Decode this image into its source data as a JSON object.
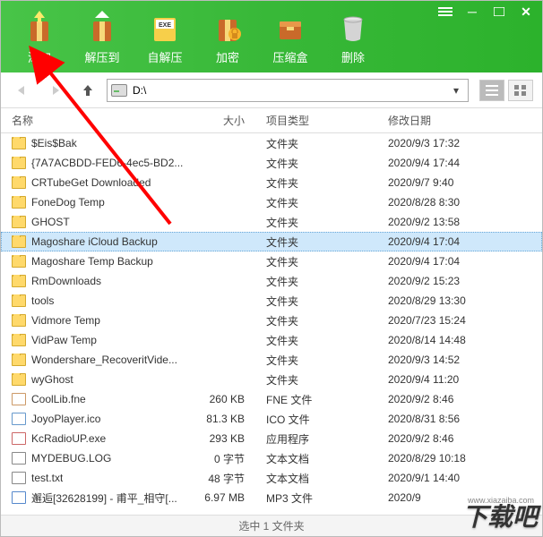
{
  "toolbar": {
    "add": "添加",
    "extract": "解压到",
    "sfx": "自解压",
    "encrypt": "加密",
    "archive_box": "压缩盒",
    "delete": "删除"
  },
  "nav": {
    "path": "D:\\"
  },
  "columns": {
    "name": "名称",
    "size": "大小",
    "type": "项目类型",
    "date": "修改日期"
  },
  "files": [
    {
      "icon": "folder",
      "name": "$Eis$Bak",
      "size": "",
      "type": "文件夹",
      "date": "2020/9/3 17:32",
      "selected": false
    },
    {
      "icon": "folder",
      "name": "{7A7ACBDD-FED6-4ec5-BD2...",
      "size": "",
      "type": "文件夹",
      "date": "2020/9/4 17:44",
      "selected": false
    },
    {
      "icon": "folder",
      "name": "CRTubeGet Downloaded",
      "size": "",
      "type": "文件夹",
      "date": "2020/9/7 9:40",
      "selected": false
    },
    {
      "icon": "folder",
      "name": "FoneDog Temp",
      "size": "",
      "type": "文件夹",
      "date": "2020/8/28 8:30",
      "selected": false
    },
    {
      "icon": "folder",
      "name": "GHOST",
      "size": "",
      "type": "文件夹",
      "date": "2020/9/2 13:58",
      "selected": false
    },
    {
      "icon": "folder",
      "name": "Magoshare iCloud Backup",
      "size": "",
      "type": "文件夹",
      "date": "2020/9/4 17:04",
      "selected": true
    },
    {
      "icon": "folder",
      "name": "Magoshare Temp Backup",
      "size": "",
      "type": "文件夹",
      "date": "2020/9/4 17:04",
      "selected": false
    },
    {
      "icon": "folder",
      "name": "RmDownloads",
      "size": "",
      "type": "文件夹",
      "date": "2020/9/2 15:23",
      "selected": false
    },
    {
      "icon": "folder",
      "name": "tools",
      "size": "",
      "type": "文件夹",
      "date": "2020/8/29 13:30",
      "selected": false
    },
    {
      "icon": "folder",
      "name": "Vidmore Temp",
      "size": "",
      "type": "文件夹",
      "date": "2020/7/23 15:24",
      "selected": false
    },
    {
      "icon": "folder",
      "name": "VidPaw Temp",
      "size": "",
      "type": "文件夹",
      "date": "2020/8/14 14:48",
      "selected": false
    },
    {
      "icon": "folder",
      "name": "Wondershare_RecoveritVide...",
      "size": "",
      "type": "文件夹",
      "date": "2020/9/3 14:52",
      "selected": false
    },
    {
      "icon": "folder",
      "name": "wyGhost",
      "size": "",
      "type": "文件夹",
      "date": "2020/9/4 11:20",
      "selected": false
    },
    {
      "icon": "file fne",
      "name": "CoolLib.fne",
      "size": "260 KB",
      "type": "FNE 文件",
      "date": "2020/9/2 8:46",
      "selected": false
    },
    {
      "icon": "file ico",
      "name": "JoyoPlayer.ico",
      "size": "81.3 KB",
      "type": "ICO 文件",
      "date": "2020/8/31 8:56",
      "selected": false
    },
    {
      "icon": "file exe",
      "name": "KcRadioUP.exe",
      "size": "293 KB",
      "type": "应用程序",
      "date": "2020/9/2 8:46",
      "selected": false
    },
    {
      "icon": "file txt",
      "name": "MYDEBUG.LOG",
      "size": "0 字节",
      "type": "文本文档",
      "date": "2020/8/29 10:18",
      "selected": false
    },
    {
      "icon": "file txt",
      "name": "test.txt",
      "size": "48 字节",
      "type": "文本文档",
      "date": "2020/9/1 14:40",
      "selected": false
    },
    {
      "icon": "file mp3",
      "name": "邂逅[32628199] - 甫平_相守[...",
      "size": "6.97 MB",
      "type": "MP3 文件",
      "date": "2020/9",
      "selected": false
    }
  ],
  "status": "选中 1 文件夹",
  "watermark": {
    "site": "www.xiazaiba.com",
    "brand": "下载吧"
  },
  "colors": {
    "accent": "#38b838",
    "selection": "#cfe8fb",
    "arrow": "#ff0000"
  }
}
